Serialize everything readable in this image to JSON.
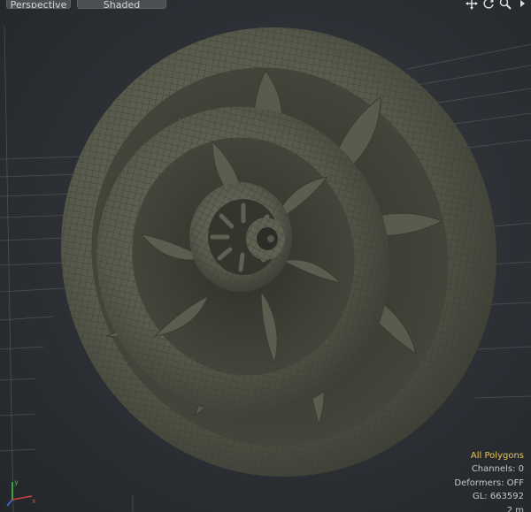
{
  "viewport": {
    "view_label": "Perspective",
    "shading_label": "Shaded",
    "tools": [
      {
        "name": "move-view-icon"
      },
      {
        "name": "rotate-view-icon"
      },
      {
        "name": "zoom-view-icon"
      },
      {
        "name": "viewport-menu-arrow-icon"
      }
    ]
  },
  "stats": {
    "selection_mode": "All Polygons",
    "channels": "Channels: 0",
    "deformers": "Deformers: OFF",
    "gl": "GL: 663592",
    "scale": "2 m"
  },
  "colors": {
    "background": "#2c3035",
    "mesh": "#5d5e50",
    "wire": "#45463c",
    "grid": "#6a6e73",
    "highlight": "#e8c35a"
  }
}
